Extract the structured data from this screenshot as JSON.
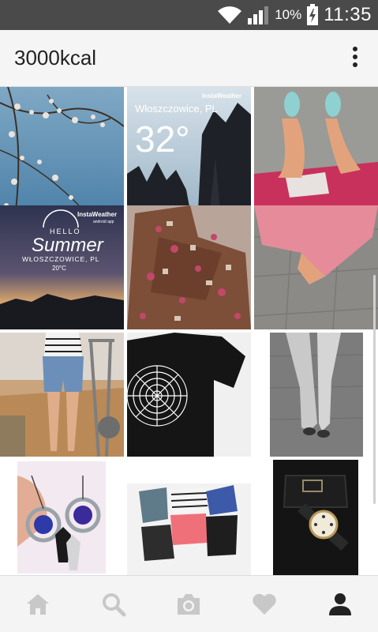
{
  "status_bar": {
    "battery_percent": "10%",
    "time": "11:35",
    "icons": [
      "wifi-icon",
      "signal-icon",
      "battery-charging-icon"
    ]
  },
  "app_bar": {
    "title": "3000kcal",
    "menu_icon": "more-vertical-icon"
  },
  "grid": {
    "weather_tile": {
      "city": "Włoszczowice, PL",
      "temperature": "32°",
      "brand": "InstaWeather"
    },
    "summer_tile": {
      "brand": "InstaWeather",
      "brand_sub": "android app",
      "hello": "HELLO",
      "title": "Summer",
      "city": "WŁOSZCZOWICE, PL",
      "temp": "20°C"
    }
  },
  "bottom_nav": {
    "items": [
      "home-icon",
      "search-icon",
      "camera-icon",
      "heart-icon",
      "profile-icon"
    ],
    "active": "profile-icon"
  },
  "colors": {
    "status_bar": "#4a4a4a",
    "app_bar": "#f5f5f5",
    "nav_inactive": "#c8c8c8",
    "nav_active": "#222222"
  }
}
